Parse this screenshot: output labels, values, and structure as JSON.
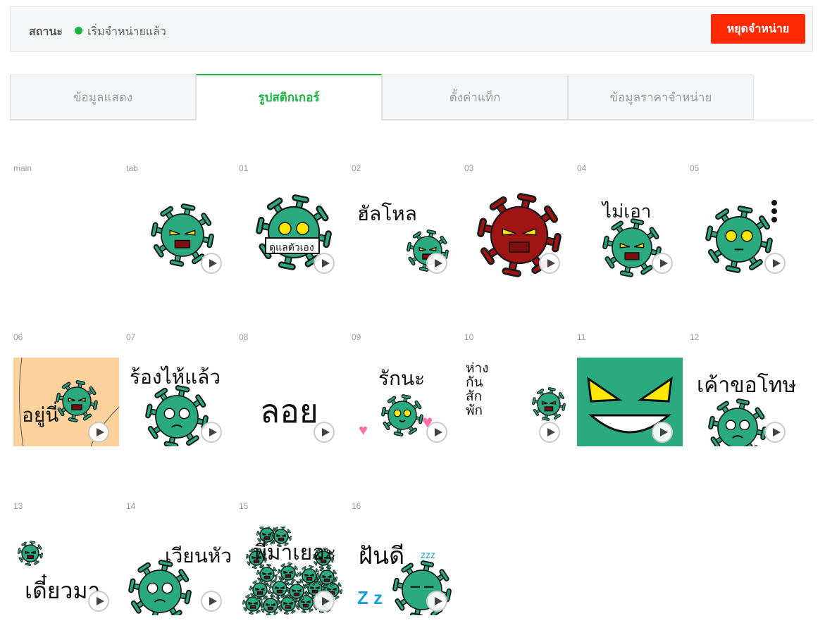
{
  "status": {
    "label": "สถานะ",
    "value": "เริ่มจำหน่ายแล้ว",
    "dot_color": "#1db446",
    "stop_button": "หยุดจำหน่าย",
    "stop_button_color": "#ff2a00"
  },
  "tabs": [
    {
      "label": "ข้อมูลแสดง",
      "active": false
    },
    {
      "label": "รูปสติกเกอร์",
      "active": true
    },
    {
      "label": "ตั้งค่าแท็ก",
      "active": false
    },
    {
      "label": "ข้อมูลราคาจำหน่าย",
      "active": false
    }
  ],
  "accent_color": "#1db446",
  "stickers": [
    {
      "label": "main",
      "text": "",
      "play_icon": "none"
    },
    {
      "label": "tab",
      "text": "",
      "play_icon": "play-icon"
    },
    {
      "label": "01",
      "text": "ดูแลตัวเอง",
      "play_icon": "play-icon"
    },
    {
      "label": "02",
      "text": "ฮัลโหล",
      "play_icon": "play-icon"
    },
    {
      "label": "03",
      "text": "",
      "play_icon": "play-icon"
    },
    {
      "label": "04",
      "text": "ไม่เอา",
      "play_icon": "play-icon"
    },
    {
      "label": "05",
      "text": "",
      "play_icon": "play-icon"
    },
    {
      "label": "06",
      "text": "อยู่นี่",
      "play_icon": "play-icon"
    },
    {
      "label": "07",
      "text": "ร้องไห้แล้ว",
      "play_icon": "play-icon"
    },
    {
      "label": "08",
      "text": "ลอย",
      "play_icon": "play-icon"
    },
    {
      "label": "09",
      "text": "รักนะ",
      "play_icon": "play-icon"
    },
    {
      "label": "10",
      "text": "ห่าง กัน สัก พัก",
      "play_icon": "play-icon"
    },
    {
      "label": "11",
      "text": "",
      "play_icon": "play-icon"
    },
    {
      "label": "12",
      "text": "เค้าขอโทษ",
      "play_icon": "play-icon"
    },
    {
      "label": "13",
      "text": "เดี๋ยวมา",
      "play_icon": "play-icon"
    },
    {
      "label": "14",
      "text": "เวียนหัว",
      "play_icon": "play-icon"
    },
    {
      "label": "15",
      "text": "พี่มาเยอะ",
      "play_icon": "play-icon"
    },
    {
      "label": "16",
      "text": "ฝันดี",
      "play_icon": "play-icon"
    }
  ]
}
